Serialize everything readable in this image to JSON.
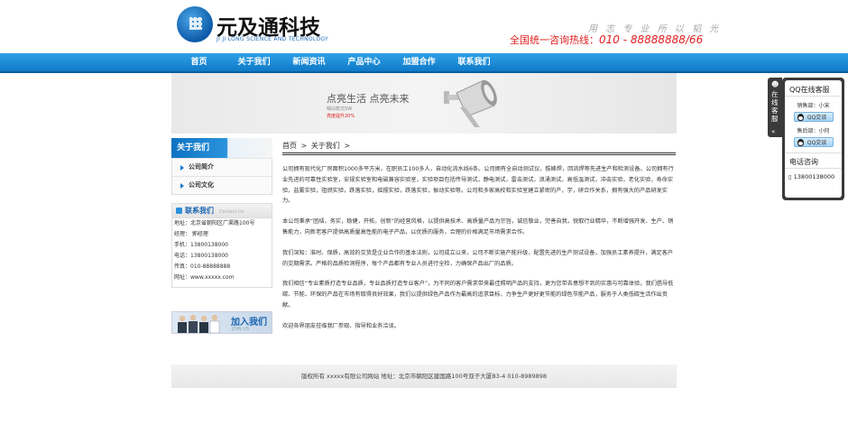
{
  "header": {
    "logo_cn": "元及通科技",
    "logo_en": "JI JI LONG SCIENCE AND TECHNOLOGY",
    "slogan": "用 志 专 业   所 以 韬 光",
    "hotline_label": "全国统一咨询热线：",
    "hotline_number": "010 - 88888888/66"
  },
  "nav": {
    "items": [
      {
        "label": "首页"
      },
      {
        "label": "关于我们"
      },
      {
        "label": "新闻资讯"
      },
      {
        "label": "产品中心"
      },
      {
        "label": "加盟合作"
      },
      {
        "label": "联系我们"
      }
    ]
  },
  "banner": {
    "title": "点亮生活 点亮未来",
    "subtitle": "晴白款式5W",
    "promo": "亮度提升20%"
  },
  "sidebar": {
    "heading": "关于我们",
    "items": [
      {
        "label": "公司简介"
      },
      {
        "label": "公司文化"
      }
    ],
    "contact": {
      "heading": "联系我们",
      "heading_en": "Contact Us",
      "lines": [
        "地址：北京省朝阳区广渠路100号",
        "经理：  郭经理",
        "手机：13800138000",
        "电话：13800138000",
        "传真：010-88888888",
        "网址：www.xxxxx.com"
      ]
    },
    "join": {
      "label": "加入我们",
      "label_en": "JOIN US"
    }
  },
  "main": {
    "breadcrumb": [
      "首页",
      ">",
      "关于我们",
      ">"
    ],
    "paragraphs": [
      "公司拥有现代化厂房面积1000多平方米，在职员工100多人，自动化流水线6条。公司拥有全自动测试仪，拔峰焊，回流焊等先进生产和检测设备。公司拥有行业先进的可靠性实验室，安规实验室和电磁兼容实验室，实验项目包括传导测试，静电测试，雷击测试，浪涌测试，高低温测试，冲击实验，老化实验，寿命实验，盐雾实验，阻燃实验，跌落实验，摇摆实验，跌落实验，振动实验等。公司和多家高校和实验室建立紧密的产，学，研合作关系，拥有强大的产品研发实力。",
      "本公司秉承“团结，务实，稳健，开拓，创新”的经营风格，以提供高技术、高质量产品为宗旨，诚信敬业，完善自我，锐取行业精华，不断增强开发、生产、销售能力，向新老客户提供高质量高性能的电子产品，以优质的服务，合理的价格满足市场需求合作。",
      "我们深知：准时、保质，高效的交货是企业合作的基本法则，公司成立以来，公司不断实施产能升级，配置先进的生产测试设备，加强员工素养提升，满足客户的交期需求。严格的品质检测程序，每个产品都有专业人员进行全检，力确保产品出厂的品质。",
      "我们相信“专业素质打造专业品质，专业品质打造专业客户”，为不同的客户需求带来最佳照明产品的支持，更为您带去意想不到的实惠与可靠体验，我们倡导低碳、节能、环保的产品在市场有取得良好效果，我们以提供绿色产品作为最高的追求目标，力争生产更好更节能的绿色节能产品，服务于人类低碳生活作出贡献。",
      "欢迎各界朋友莅临我厂参观、指导和业务洽谈。"
    ]
  },
  "footer": {
    "text": "版权所有 xxxxx有限公司网站 地址：北京市朝阳区建国路100号双子大厦B3-4 010-8989898"
  },
  "qq_panel": {
    "tab_text": "在线客服",
    "title": "QQ在线客服",
    "agents": [
      {
        "role": "销售部：小宋",
        "button": "QQ交谈"
      },
      {
        "role": "售后部：小何",
        "button": "QQ交谈"
      }
    ],
    "phone_title": "电话咨询",
    "phone_number": "13800138000"
  }
}
